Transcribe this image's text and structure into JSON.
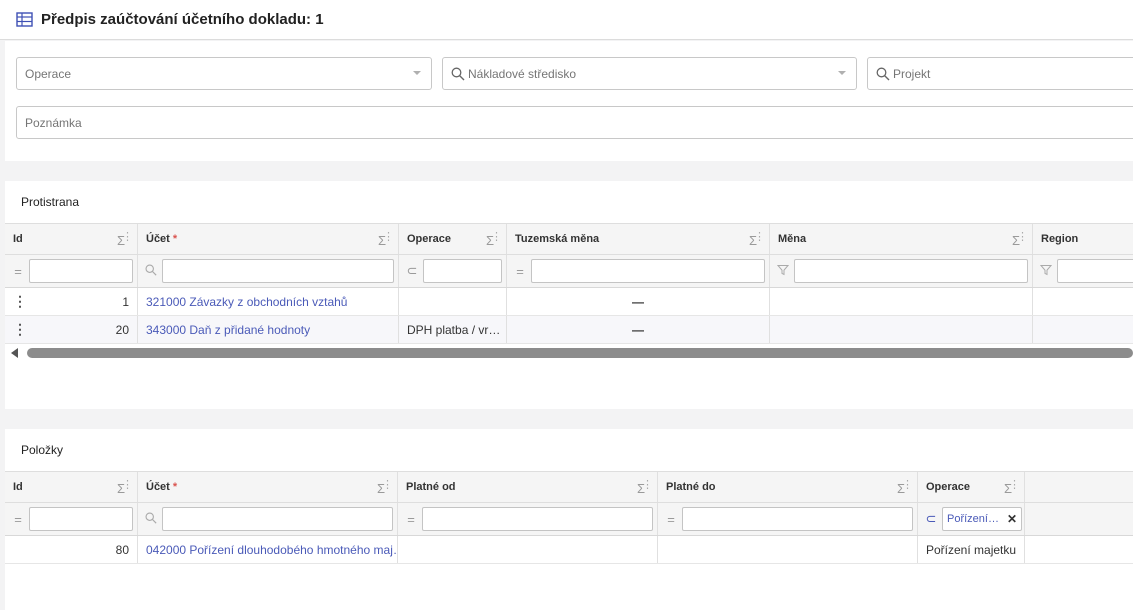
{
  "header": {
    "title": "Předpis zaúčtování účetního dokladu: 1"
  },
  "form": {
    "operace_placeholder": "Operace",
    "stredisko_placeholder": "Nákladové středisko",
    "projekt_placeholder": "Projekt",
    "poznamka_placeholder": "Poznámka"
  },
  "protistrana": {
    "title": "Protistrana",
    "columns": [
      "Id",
      "Účet",
      "Operace",
      "Tuzemská měna",
      "Měna",
      "Region"
    ],
    "required_mark": "*",
    "filter_ops": [
      "=",
      "⚲",
      "⊂",
      "=",
      "⏷",
      "⏷"
    ],
    "rows": [
      {
        "id": "1",
        "ucet": "321000 Závazky z obchodních vztahů",
        "operace": "",
        "tuzemska": "—",
        "mena": "",
        "region": ""
      },
      {
        "id": "20",
        "ucet": "343000 Daň z přidané hodnoty",
        "operace": "DPH platba / vr…",
        "tuzemska": "—",
        "mena": "",
        "region": ""
      }
    ]
  },
  "polozky": {
    "title": "Položky",
    "columns": [
      "Id",
      "Účet",
      "Platné od",
      "Platné do",
      "Operace"
    ],
    "required_mark": "*",
    "operace_filter_chip": "Pořízení…",
    "rows": [
      {
        "id": "80",
        "ucet": "042000 Pořízení dlouhodobého hmotného maj…",
        "platne_od": "",
        "platne_do": "",
        "operace": "Pořízení majetku"
      }
    ]
  },
  "symbols": {
    "sigma": "Σ",
    "dots": "⋮",
    "eq": "=",
    "subset": "⊂",
    "close": "✕"
  },
  "colors": {
    "link": "#4a5ab8",
    "required": "#d9534f",
    "title_icon": "#3f51b5"
  }
}
